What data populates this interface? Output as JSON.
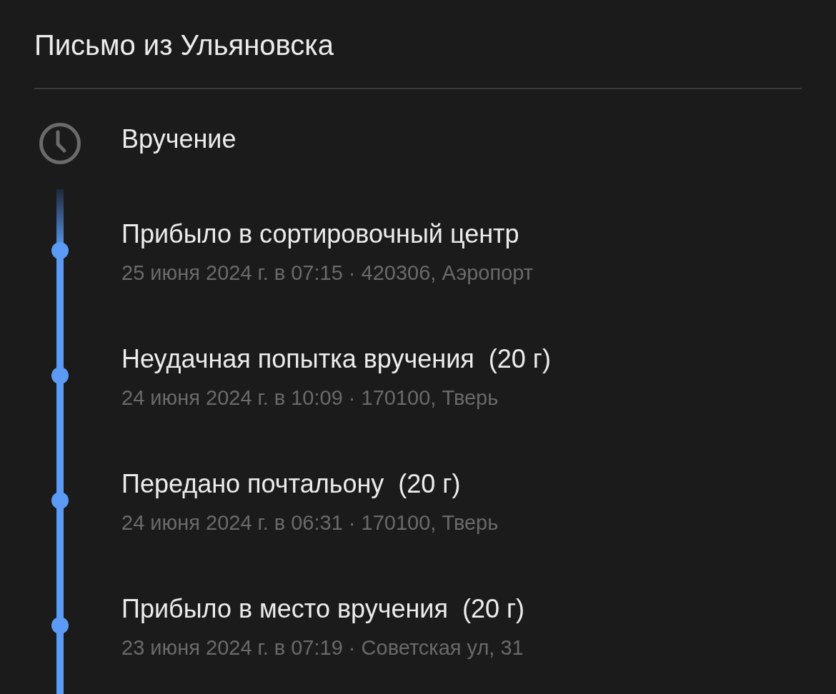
{
  "title": "Письмо из Ульяновска",
  "pending": {
    "label": "Вручение"
  },
  "events": [
    {
      "title": "Прибыло в сортировочный центр",
      "details": "25 июня 2024 г. в 07:15 · 420306, Аэропорт"
    },
    {
      "title": "Неудачная попытка вручения  (20 г)",
      "details": "24 июня 2024 г. в 10:09 · 170100, Тверь"
    },
    {
      "title": "Передано почтальону  (20 г)",
      "details": "24 июня 2024 г. в 06:31 · 170100, Тверь"
    },
    {
      "title": "Прибыло в место вручения  (20 г)",
      "details": "23 июня 2024 г. в 07:19 · Советская ул, 31"
    }
  ]
}
